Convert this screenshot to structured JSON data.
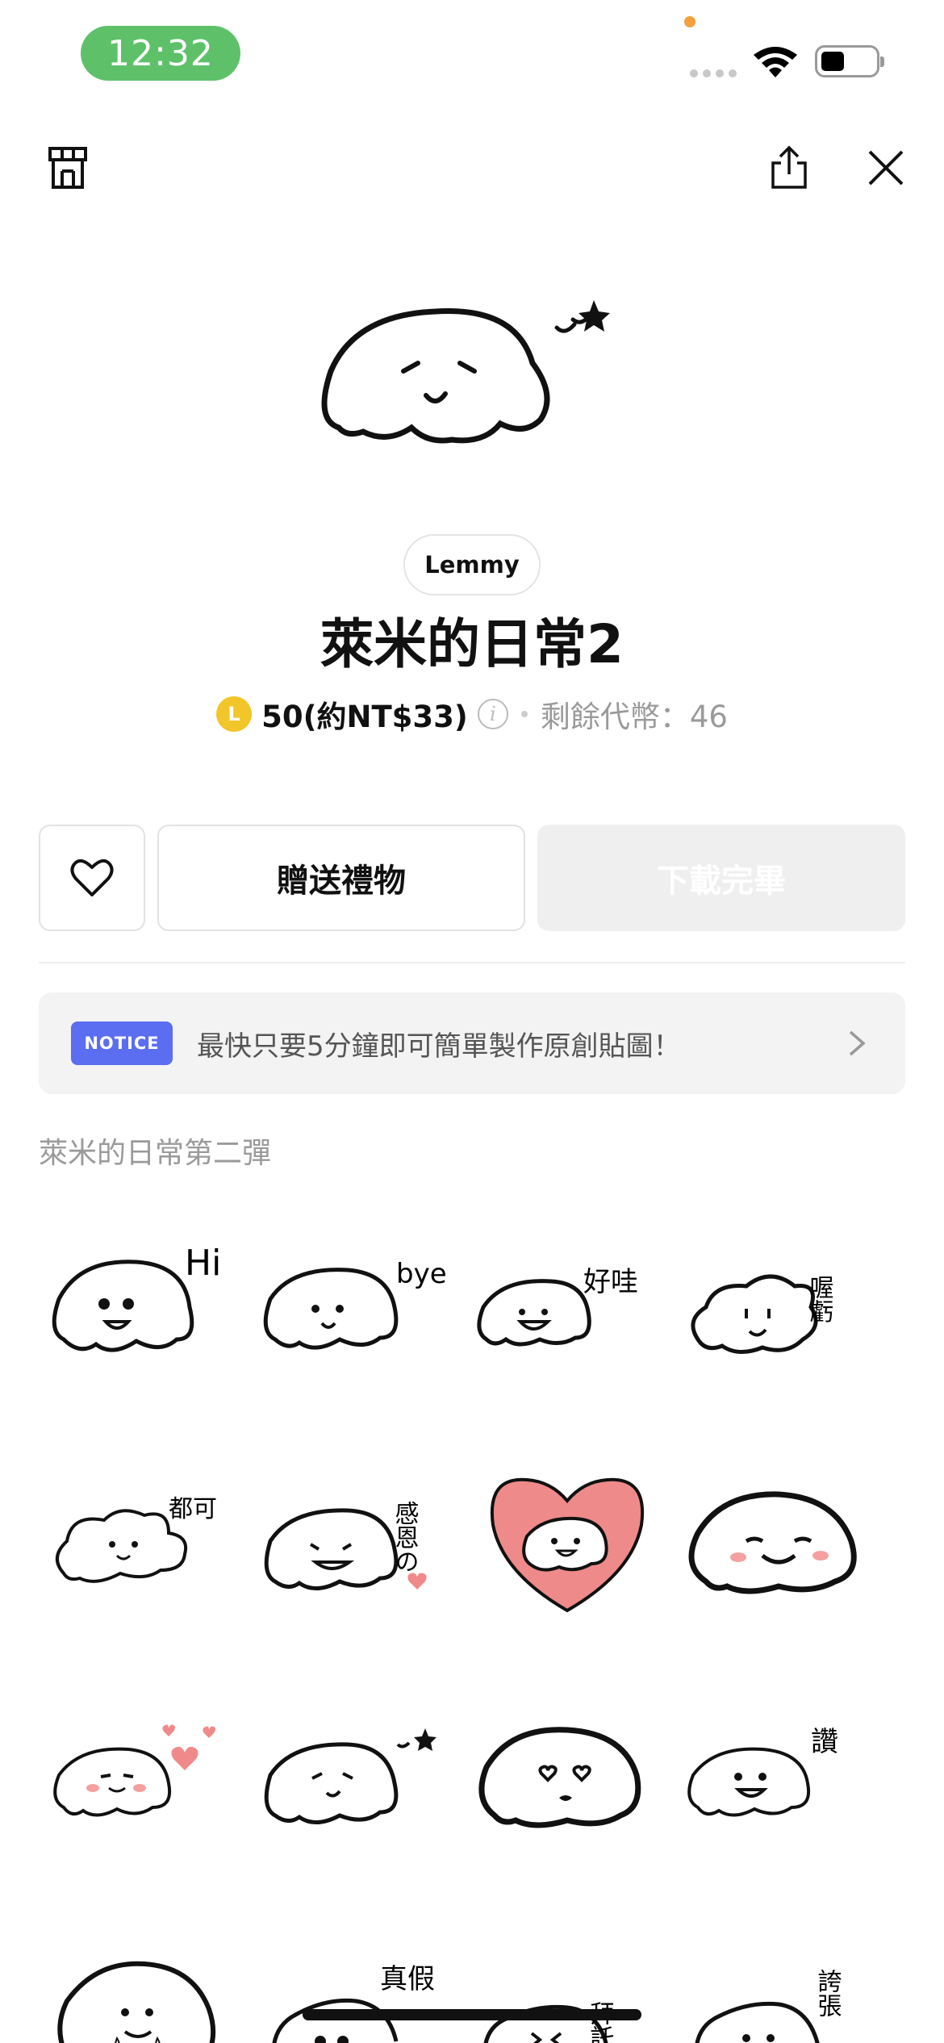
{
  "status_bar": {
    "time": "12:32"
  },
  "toolbar": {
    "shop_icon": "shop-icon",
    "share_icon": "share-icon",
    "close_icon": "close-icon"
  },
  "product": {
    "author": "Lemmy",
    "title": "萊米的日常2",
    "coin_symbol": "L",
    "price": "50(約NT$33)",
    "info_icon": "i",
    "balance": "剩餘代幣：46"
  },
  "actions": {
    "favorite_icon": "heart-icon",
    "gift_label": "贈送禮物",
    "download_label": "下載完畢"
  },
  "notice": {
    "badge": "NOTICE",
    "text": "最快只要5分鐘即可簡單製作原創貼圖！"
  },
  "description": "萊米的日常第二彈",
  "stickers": [
    {
      "caption": "Hi"
    },
    {
      "caption": "bye"
    },
    {
      "caption": "好哇"
    },
    {
      "caption": "喔虧"
    },
    {
      "caption": "都可"
    },
    {
      "caption": "感恩の"
    },
    {
      "caption": ""
    },
    {
      "caption": ""
    },
    {
      "caption": ""
    },
    {
      "caption": ""
    },
    {
      "caption": ""
    },
    {
      "caption": "讚"
    },
    {
      "caption": ""
    },
    {
      "caption": "真假"
    },
    {
      "caption": "拜託"
    },
    {
      "caption": "誇張"
    }
  ],
  "colors": {
    "green_pill": "#5ec16a",
    "notice_badge": "#5b6df0",
    "coin": "#f2c52a",
    "heart_pink": "#f08a8a"
  }
}
